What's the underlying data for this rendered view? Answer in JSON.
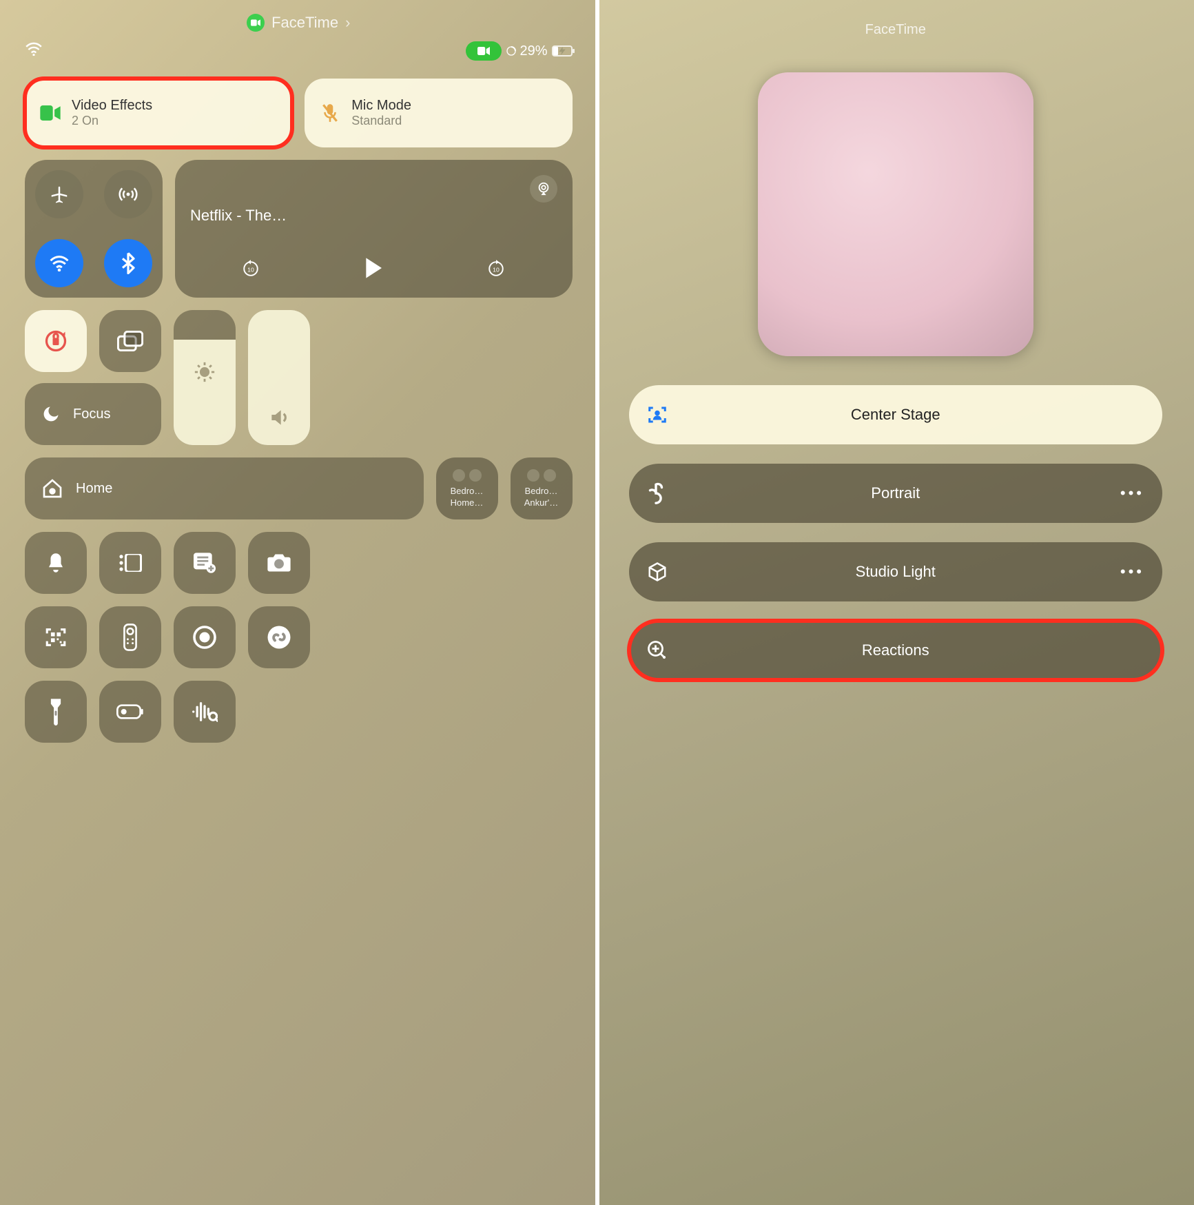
{
  "left": {
    "header_app": "FaceTime",
    "battery_percent": "29%",
    "video_effects": {
      "title": "Video Effects",
      "subtitle": "2 On"
    },
    "mic_mode": {
      "title": "Mic Mode",
      "subtitle": "Standard"
    },
    "media_title": "Netflix - The…",
    "focus_label": "Focus",
    "home_label": "Home",
    "accessory1": {
      "line1": "Bedro…",
      "line2": "Home…"
    },
    "accessory2": {
      "line1": "Bedro…",
      "line2": "Ankur'…"
    }
  },
  "right": {
    "title": "FaceTime",
    "opts": {
      "center_stage": "Center Stage",
      "portrait": "Portrait",
      "studio_light": "Studio Light",
      "reactions": "Reactions"
    }
  }
}
